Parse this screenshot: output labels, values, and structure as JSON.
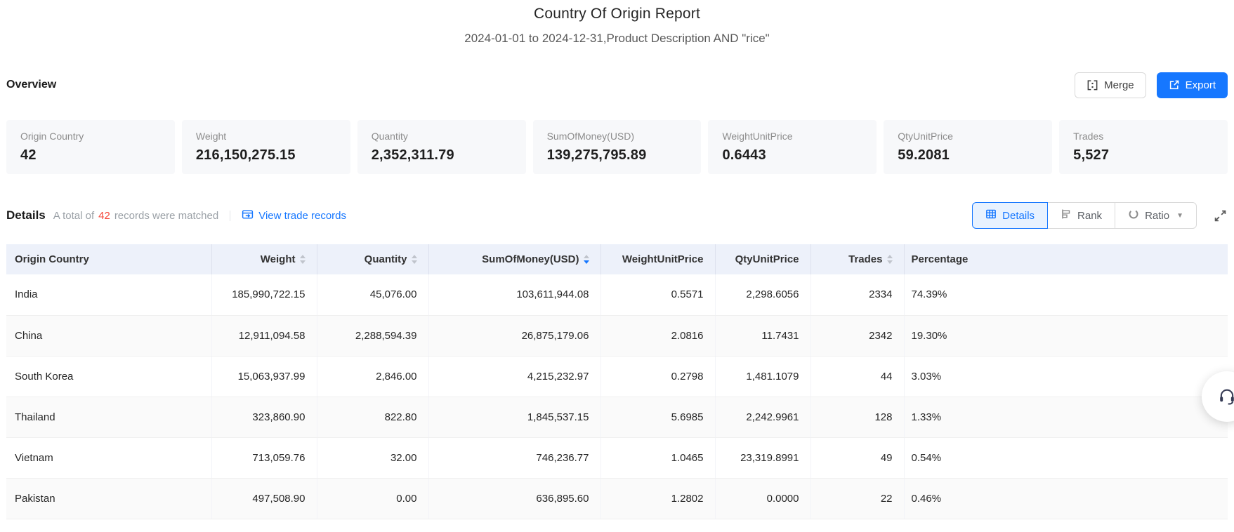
{
  "report": {
    "title": "Country Of Origin Report",
    "subtitle": "2024-01-01 to 2024-12-31,Product Description AND \"rice\""
  },
  "overview": {
    "heading": "Overview",
    "merge_label": "Merge",
    "export_label": "Export",
    "cards": [
      {
        "label": "Origin Country",
        "value": "42"
      },
      {
        "label": "Weight",
        "value": "216,150,275.15"
      },
      {
        "label": "Quantity",
        "value": "2,352,311.79"
      },
      {
        "label": "SumOfMoney(USD)",
        "value": "139,275,795.89"
      },
      {
        "label": "WeightUnitPrice",
        "value": "0.6443"
      },
      {
        "label": "QtyUnitPrice",
        "value": "59.2081"
      },
      {
        "label": "Trades",
        "value": "5,527"
      }
    ]
  },
  "details": {
    "heading": "Details",
    "summary_prefix": "A total of",
    "summary_count": "42",
    "summary_suffix": "records were matched",
    "link_label": "View trade records",
    "tabs": [
      {
        "label": "Details",
        "active": true,
        "dropdown": false
      },
      {
        "label": "Rank",
        "active": false,
        "dropdown": false
      },
      {
        "label": "Ratio",
        "active": false,
        "dropdown": true
      }
    ],
    "ratio_caret_glyph": "▼"
  },
  "table": {
    "columns": [
      {
        "label": "Origin Country",
        "align": "left",
        "sortable": false,
        "sort": null
      },
      {
        "label": "Weight",
        "align": "right",
        "sortable": true,
        "sort": null
      },
      {
        "label": "Quantity",
        "align": "right",
        "sortable": true,
        "sort": null
      },
      {
        "label": "SumOfMoney(USD)",
        "align": "right",
        "sortable": true,
        "sort": "desc"
      },
      {
        "label": "WeightUnitPrice",
        "align": "right",
        "sortable": false,
        "sort": null
      },
      {
        "label": "QtyUnitPrice",
        "align": "right",
        "sortable": false,
        "sort": null
      },
      {
        "label": "Trades",
        "align": "right",
        "sortable": true,
        "sort": null
      },
      {
        "label": "Percentage",
        "align": "left",
        "sortable": false,
        "sort": null
      }
    ],
    "rows": [
      [
        "India",
        "185,990,722.15",
        "45,076.00",
        "103,611,944.08",
        "0.5571",
        "2,298.6056",
        "2334",
        "74.39%"
      ],
      [
        "China",
        "12,911,094.58",
        "2,288,594.39",
        "26,875,179.06",
        "2.0816",
        "11.7431",
        "2342",
        "19.30%"
      ],
      [
        "South Korea",
        "15,063,937.99",
        "2,846.00",
        "4,215,232.97",
        "0.2798",
        "1,481.1079",
        "44",
        "3.03%"
      ],
      [
        "Thailand",
        "323,860.90",
        "822.80",
        "1,845,537.15",
        "5.6985",
        "2,242.9961",
        "128",
        "1.33%"
      ],
      [
        "Vietnam",
        "713,059.76",
        "32.00",
        "746,236.77",
        "1.0465",
        "23,319.8991",
        "49",
        "0.54%"
      ],
      [
        "Pakistan",
        "497,508.90",
        "0.00",
        "636,895.60",
        "1.2802",
        "0.0000",
        "22",
        "0.46%"
      ]
    ]
  },
  "colors": {
    "accent_blue": "#1677ff",
    "count_red": "#f5483b",
    "header_bg": "#edf1fa",
    "card_bg": "#f7f8fa"
  }
}
